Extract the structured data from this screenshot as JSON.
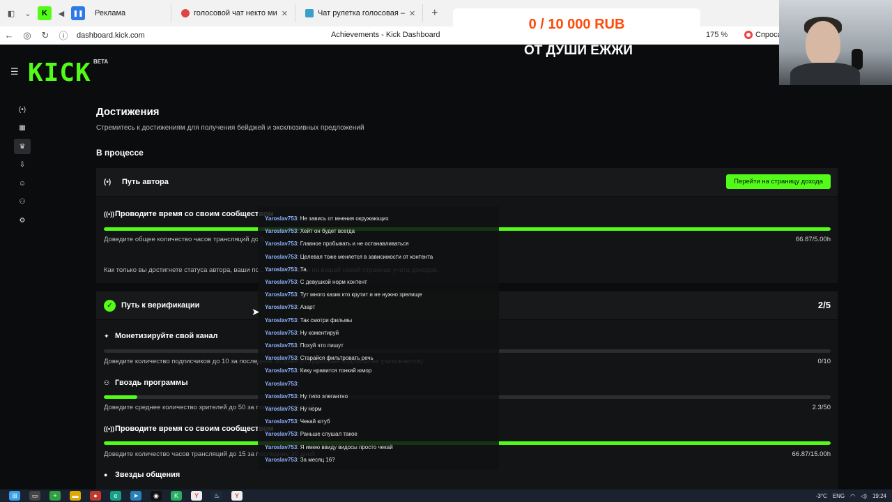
{
  "browser": {
    "tabs": [
      {
        "label": "Реклама",
        "favicon": "pause-icon"
      },
      {
        "label": "голосовой чат некто ми",
        "favicon": "red-circle-icon"
      },
      {
        "label": "Чат рулетка голосовая –",
        "favicon": "chat-icon"
      }
    ],
    "url": "dashboard.kick.com",
    "page_title": "Achievements - Kick Dashboard",
    "zoom": "175 %",
    "ask_label": "Спроси"
  },
  "overlay": {
    "donation_goal": "0 / 10 000 RUB",
    "caption": "ОТ ДУШИ ЕЖЖИ"
  },
  "kick": {
    "logo": "KICK",
    "beta": "BETA"
  },
  "page": {
    "title": "Достижения",
    "subtitle": "Стремитесь к достижениям для получения бейджей и эксклюзивных предложений",
    "section": "В процессе"
  },
  "author_path": {
    "title": "Путь автора",
    "button": "Перейти на страницу дохода",
    "item": {
      "title": "Проводите время со своим сообществом",
      "desc": "Доведите общее количество часов трансляций до 5",
      "value": "66.87/5.00h",
      "progress": 1.0
    },
    "note": "Как только вы достигнете статуса автора, ваши по... активированы на вашей новой странице учета доходов."
  },
  "verification_path": {
    "title": "Путь к верификации",
    "count": "2/5",
    "items": [
      {
        "title": "Монетизируйте свой канал",
        "desc": "Доведите количество подписчиков до 10 за последние 30 дней (подарочные подписки не учитываются)",
        "value": "0/10",
        "progress": 0.0
      },
      {
        "title": "Гвоздь программы",
        "desc": "Доведите среднее количество зрителей до 50 за последние 30 дней",
        "value": "2.3/50",
        "progress": 0.046
      },
      {
        "title": "Проводите время со своим сообществом",
        "desc": "Доведите количество часов трансляций до 15 за последние 30 дней",
        "value": "66.87/15.00h",
        "progress": 1.0
      },
      {
        "title": "Звезды общения"
      }
    ]
  },
  "chat": {
    "user": "Yaroslav753",
    "messages": [
      "Не завись от мнения окружающих",
      "Хейт он будет всегда",
      "Главное пробывать и не останавливаться",
      "Целевая тоже меняется в зависимости от контента",
      "Та",
      "С девушкой норм контент",
      "Тут много казик кто крутит и не нужно зрелище",
      "Азарт",
      "Так смотри фильмы",
      "Ну коментируй",
      "Похуй что пишут",
      "Старайся фильтровать речь",
      "Кику нравится тонкий юмор",
      "",
      "Ну типо элегантно",
      "Ну норм",
      "Чекай ютуб",
      "Раньше слушал такое",
      "Я имею ввиду видосы просто чекай",
      "За месяц 16?"
    ]
  },
  "taskbar": {
    "weather": "-3°C",
    "lang": "ENG",
    "time": "19:24"
  },
  "colors": {
    "accent": "#53fc18",
    "donation": "#ff4a0a",
    "chat_user": "#8fb2ff"
  }
}
